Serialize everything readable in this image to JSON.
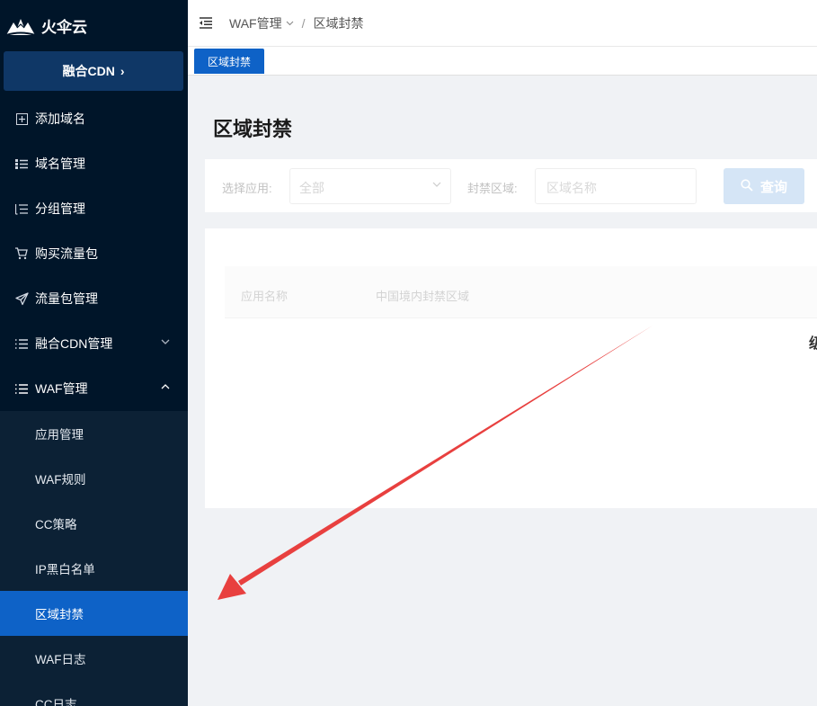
{
  "app": {
    "name": "火伞云",
    "cdn_button": "融合CDN",
    "cdn_button_icon": "chevron-right-icon"
  },
  "sidebar": {
    "items": [
      {
        "label": "添加域名",
        "icon": "plus-square-icon"
      },
      {
        "label": "域名管理",
        "icon": "list-dot-icon"
      },
      {
        "label": "分组管理",
        "icon": "list-check-icon"
      },
      {
        "label": "购买流量包",
        "icon": "cart-icon"
      },
      {
        "label": "流量包管理",
        "icon": "send-icon"
      },
      {
        "label": "融合CDN管理",
        "icon": "menu-list-icon",
        "expanded": false
      },
      {
        "label": "WAF管理",
        "icon": "menu-list-icon",
        "expanded": true
      }
    ],
    "waf_sub": [
      {
        "label": "应用管理",
        "active": false
      },
      {
        "label": "WAF规则",
        "active": false
      },
      {
        "label": "CC策略",
        "active": false
      },
      {
        "label": "IP黑白名单",
        "active": false
      },
      {
        "label": "区域封禁",
        "active": true
      },
      {
        "label": "WAF日志",
        "active": false
      },
      {
        "label": "CC日志",
        "active": false
      }
    ]
  },
  "header": {
    "breadcrumb": {
      "parent": "WAF管理",
      "separator": "/",
      "current": "区域封禁"
    }
  },
  "tabs": [
    {
      "label": "区域封禁",
      "active": true
    }
  ],
  "page": {
    "title": "区域封禁"
  },
  "filter": {
    "app_label": "选择应用:",
    "app_value": "全部",
    "region_label": "封禁区域:",
    "region_placeholder": "区域名称",
    "query_button": "查询"
  },
  "table": {
    "columns": [
      "应用名称",
      "中国境内封禁区域"
    ],
    "edge_char": "级"
  },
  "colors": {
    "sidebar_bg": "#001529",
    "accent": "#0e62c7",
    "arrow": "#e8403f"
  }
}
